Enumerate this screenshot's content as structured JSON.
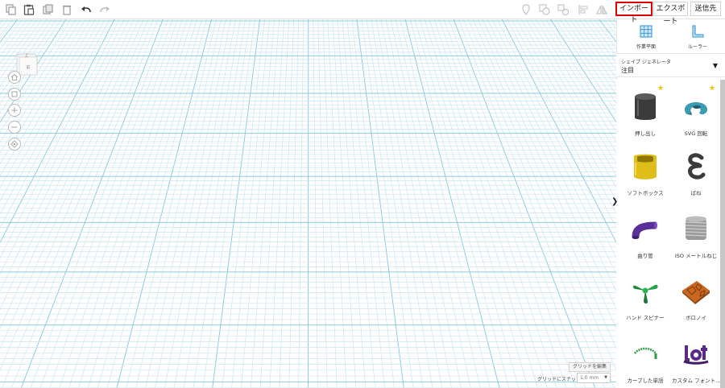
{
  "toolbar": {
    "left_icons": [
      "copy-icon",
      "paste-icon",
      "duplicate-icon",
      "delete-icon",
      "undo-icon",
      "redo-icon"
    ],
    "right_icons": [
      "note-icon",
      "group-icon",
      "ungroup-icon",
      "align-icon",
      "mirror-icon"
    ],
    "import_label": "インポート",
    "export_label": "エクスポート",
    "send_label": "送信先"
  },
  "navcube": {
    "top_label": "上",
    "front_label": "前"
  },
  "nav_controls": [
    "home-icon",
    "fit-icon",
    "zoom-in-icon",
    "zoom-out-icon",
    "perspective-icon"
  ],
  "grid": {
    "edit_label": "グリッドを編集",
    "snap_label": "グリッドにスナップ",
    "snap_value": "1.0 mm"
  },
  "panel": {
    "workplane_label": "作業平面",
    "ruler_label": "ルーラー",
    "shape_gen_title": "シェイプ ジェネレータ",
    "shape_gen_selected": "注目",
    "shapes": [
      {
        "label": "押し出し",
        "starred": true
      },
      {
        "label": "SVG 回転",
        "starred": true
      },
      {
        "label": "ソフトボックス",
        "starred": false
      },
      {
        "label": "ばね",
        "starred": false
      },
      {
        "label": "曲り管",
        "starred": false
      },
      {
        "label": "ISO メートルねじ",
        "starred": false
      },
      {
        "label": "ハンド スピナー",
        "starred": false
      },
      {
        "label": "ボロノイ",
        "starred": false
      },
      {
        "label": "カーブした単語",
        "starred": false
      },
      {
        "label": "カスタム フォント…",
        "starred": false
      }
    ]
  },
  "colors": {
    "grid_minor": "#cbe6f2",
    "grid_major": "#8ccbe4",
    "import_highlight": "#e00000",
    "star": "#f5c400"
  }
}
